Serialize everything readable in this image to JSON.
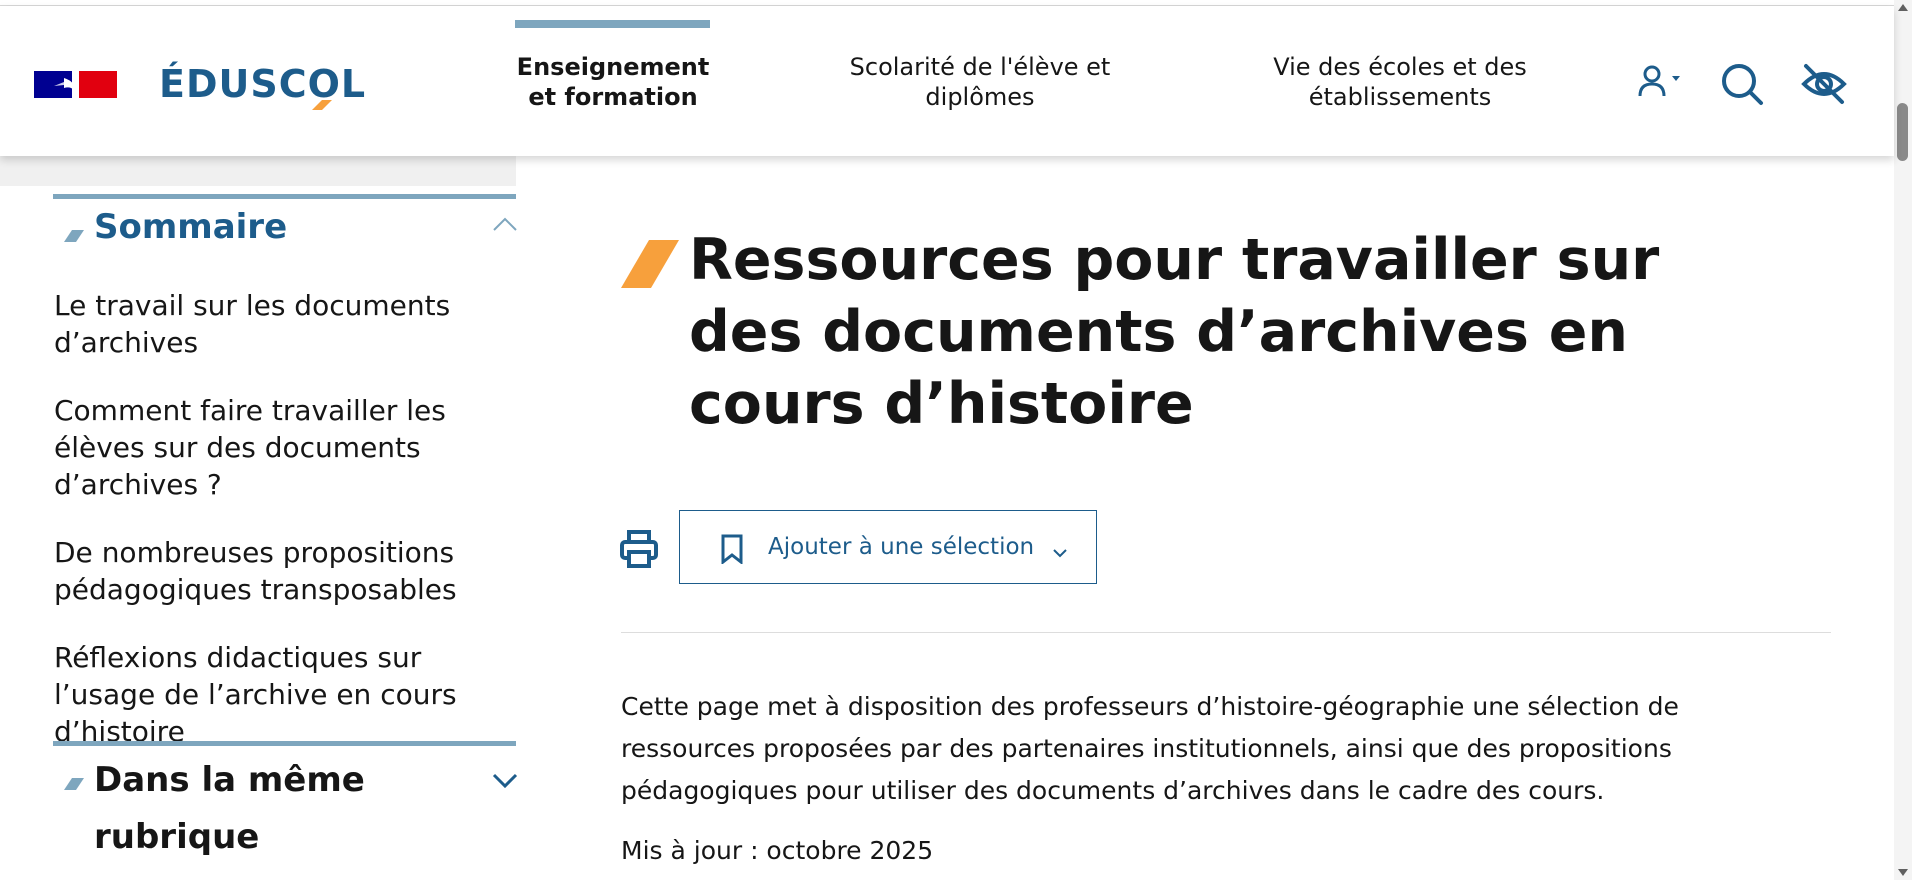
{
  "header": {
    "logo_text": "ÉDUSCOL",
    "nav": [
      {
        "label": "Enseignement et formation",
        "active": true
      },
      {
        "label": "Scolarité de l'élève et diplômes",
        "active": false
      },
      {
        "label": "Vie des écoles et des établissements",
        "active": false
      }
    ],
    "icons": [
      "user-icon",
      "search-icon",
      "accessibility-eye-icon"
    ]
  },
  "sidebar": {
    "sommaire_title": "Sommaire",
    "toc": [
      "Le travail sur les documents d’archives",
      "Comment faire travailler les élèves sur des documents d’archives ?",
      "De nombreuses propositions pédagogiques transposables",
      "Réflexions didactiques sur l’usage de l’archive en cours d’histoire"
    ],
    "same_section_title": "Dans la même rubrique"
  },
  "main": {
    "title": "Ressources pour travailler sur des documents d’archives en cours d’histoire",
    "add_selection_label": "Ajouter à une sélection",
    "intro": "Cette page met à disposition des professeurs d’histoire-géographie une sélection de ressources proposées par des partenaires institutionnels, ainsi que des propositions pédagogiques pour utiliser des documents d’archives dans le cadre des cours.",
    "updated": "Mis à jour : octobre 2025"
  },
  "colors": {
    "brand_blue": "#1d5c8b",
    "accent_orange": "#f7a03c",
    "rule_blue": "#7ea6be",
    "marianne_blue": "#000091",
    "marianne_red": "#e1000f"
  }
}
